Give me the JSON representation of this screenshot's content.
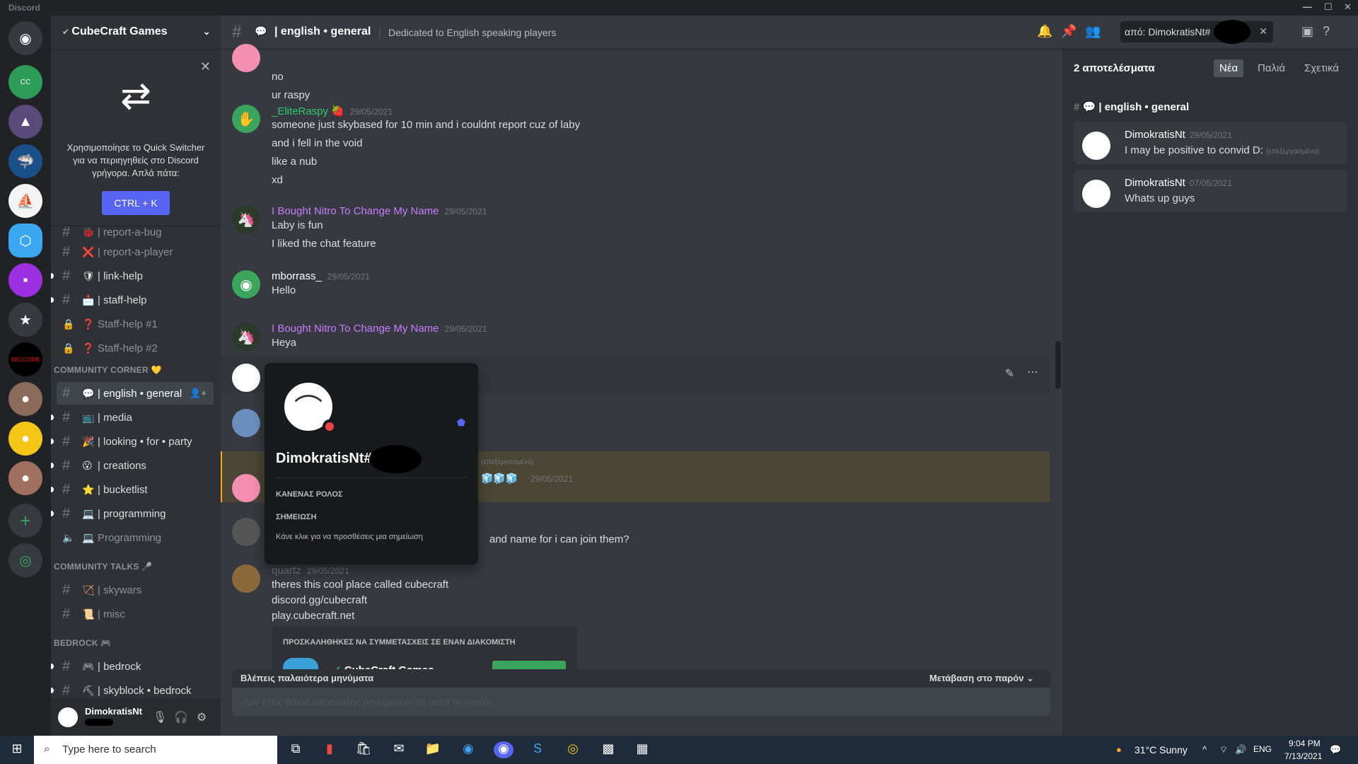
{
  "window": {
    "title": "Discord"
  },
  "server": {
    "name": "CubeCraft Games"
  },
  "quick_switcher": {
    "text": "Χρησιμοποίησε το Quick Switcher για να περιηγηθείς στο Discord γρήγορα. Απλά πάτα:",
    "shortcut": "CTRL + K"
  },
  "channels": [
    {
      "emoji": "🐞",
      "label": "| report-a-bug"
    },
    {
      "emoji": "❌",
      "label": "| report-a-player"
    },
    {
      "emoji": "🛡",
      "label": "| link-help"
    },
    {
      "emoji": "📩",
      "label": "| staff-help"
    },
    {
      "emoji": "❓",
      "label": "Staff-help #1"
    },
    {
      "emoji": "❓",
      "label": "Staff-help #2"
    },
    {
      "emoji": "💬",
      "label": "| english • general"
    },
    {
      "emoji": "📺",
      "label": "| media"
    },
    {
      "emoji": "🎉",
      "label": "| looking • for • party"
    },
    {
      "emoji": "😮",
      "label": "| creations"
    },
    {
      "emoji": "⭐",
      "label": "| bucketlist"
    },
    {
      "emoji": "💻",
      "label": "| programming"
    },
    {
      "emoji": "💻",
      "label": "Programming"
    },
    {
      "emoji": "🏹",
      "label": "| skywars"
    },
    {
      "emoji": "📜",
      "label": "| misc"
    },
    {
      "emoji": "🎮",
      "label": "| bedrock"
    },
    {
      "emoji": "⛏",
      "label": "| skyblock • bedrock"
    }
  ],
  "categories": [
    "COMMUNITY CORNER 💛",
    "COMMUNITY TALKS 🎤",
    "BEDROCK 🎮"
  ],
  "user": {
    "name": "DimokratisNt"
  },
  "channel_header": {
    "name": "| english • general",
    "topic": "Dedicated to English speaking players",
    "search": "από: DimokratisNt#"
  },
  "messages": [
    {
      "author": "",
      "ts": "",
      "lines": [
        "no",
        "ur raspy"
      ]
    },
    {
      "author": "_EliteRaspy",
      "ts": "29/05/2021",
      "lines": [
        "someone just skybased for 10 min and i couldnt report cuz of laby",
        "and i fell in the void",
        "like a nub",
        "xd"
      ]
    },
    {
      "author": "I Bought Nitro To Change My Name",
      "ts": "29/05/2021",
      "lines": [
        "Laby is fun",
        "I liked the chat feature"
      ]
    },
    {
      "author": "mborrass_",
      "ts": "29/05/2021",
      "lines": [
        "Hello"
      ]
    },
    {
      "author": "I Bought Nitro To Change My Name",
      "ts": "29/05/2021",
      "lines": [
        "Heya"
      ]
    },
    {
      "author": "",
      "ts": "29/05/2021",
      "lines": []
    },
    {
      "author": "",
      "ts": "",
      "lines": [
        "and name for i can join them?"
      ]
    },
    {
      "author": "quartz",
      "ts": "29/05/2021",
      "lines": [
        "theres this cool place called cubecraft",
        "discord.gg/cubecraft",
        "play.cubecraft.net"
      ]
    }
  ],
  "edited_label": "(επεξεργασμένο)",
  "invite": {
    "title": "ΠΡΟΣΚΑΛΗΘΗΚΕΣ ΝΑ ΣΥΜΜΕΤΑΣΧΕΙΣ ΣΕ ΕΝΑΝ ΔΙΑΚΟΜΙΣΤΗ",
    "server": "CubeCraft Games"
  },
  "older_bar": {
    "text": "Βλέπεις παλαιότερα μηνύματα",
    "jump": "Μετάβαση στο παρόν"
  },
  "input_placeholder": "Δεν έχεις άδεια αποστολής μηνυμάτων σε αυτό το κανάλι.",
  "popout": {
    "name": "DimokratisNt#",
    "roles": "ΚΑΝΕΝΑΣ ΡΟΛΟΣ",
    "note_label": "ΣΗΜΕΙΩΣΗ",
    "note_placeholder": "Κάνε κλικ για να προσθέσεις μια σημείωση"
  },
  "search_panel": {
    "results": "2 αποτελέσματα",
    "tabs": [
      "Νέα",
      "Παλιά",
      "Σχετικά"
    ],
    "channel": "| english • general",
    "results_list": [
      {
        "author": "DimokratisNt",
        "ts": "29/05/2021",
        "text": "I may be positive to convid D:",
        "edited": "(επεξεργασμένο)"
      },
      {
        "author": "DimokratisNt",
        "ts": "07/05/2021",
        "text": "Whats up guys",
        "edited": ""
      }
    ]
  },
  "taskbar": {
    "search": "Type here to search",
    "weather": "31°C  Sunny",
    "lang": "ENG",
    "time": "9:04 PM",
    "date": "7/13/2021"
  }
}
